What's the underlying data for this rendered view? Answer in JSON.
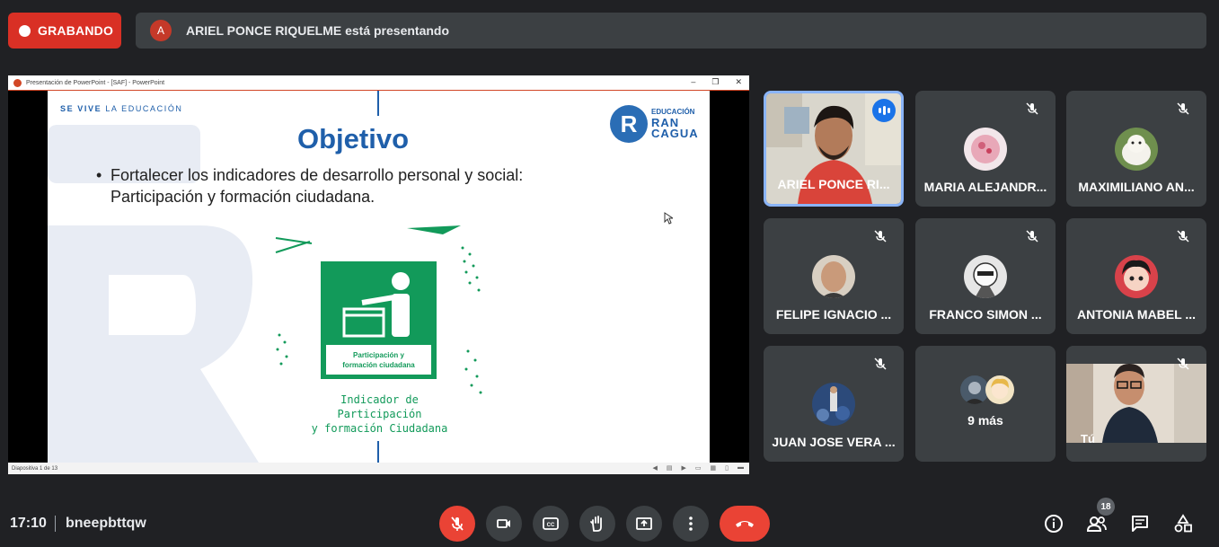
{
  "recording": {
    "label": "GRABANDO"
  },
  "presenter_bar": {
    "initial": "A",
    "text": "ARIEL PONCE RIQUELME está presentando"
  },
  "powerpoint": {
    "window_title": "Presentación de PowerPoint - [SAF] - PowerPoint",
    "status": "Diapositiva 1 de 13",
    "slide": {
      "tagline_bold": "SE VIVE",
      "tagline_rest": " LA EDUCACIÓN",
      "title": "Objetivo",
      "bullet_line1": "Fortalecer los indicadores de desarrollo personal y social:",
      "bullet_line2": "Participación y formación ciudadana.",
      "logo_letter": "R",
      "logo_small": "EDUCACIÓN",
      "logo_line1": "RAN",
      "logo_line2": "CAGUA",
      "indicator_box_line1": "Participación y",
      "indicator_box_line2": "formación ciudadana",
      "caption_line1": "Indicador de Participación",
      "caption_line2": "y formación Ciudadana"
    }
  },
  "participants": [
    {
      "name": "ARIEL PONCE RI...",
      "speaking": true
    },
    {
      "name": "MARIA ALEJANDR...",
      "muted": true
    },
    {
      "name": "MAXIMILIANO AN...",
      "muted": true
    },
    {
      "name": "FELIPE IGNACIO ...",
      "muted": true
    },
    {
      "name": "FRANCO SIMON ...",
      "muted": true
    },
    {
      "name": "ANTONIA MABEL ...",
      "muted": true
    },
    {
      "name": "JUAN JOSE VERA ...",
      "muted": true
    },
    {
      "name": "9 más"
    },
    {
      "name": "Tú",
      "muted": true
    }
  ],
  "bottom_bar": {
    "time": "17:10",
    "meeting_code": "bneepbttqw",
    "participant_count": "18",
    "icons": [
      "mic-off-icon",
      "camera-icon",
      "captions-icon",
      "raise-hand-icon",
      "present-icon",
      "more-vert-icon",
      "end-call-icon",
      "info-icon",
      "people-icon",
      "chat-icon",
      "activities-icon"
    ]
  },
  "colors": {
    "accent_red": "#ea4335",
    "background": "#202124",
    "tile": "#3c4043",
    "active_border": "#8ab4f8",
    "slide_blue": "#1f5faa",
    "slide_green": "#129a5a"
  }
}
